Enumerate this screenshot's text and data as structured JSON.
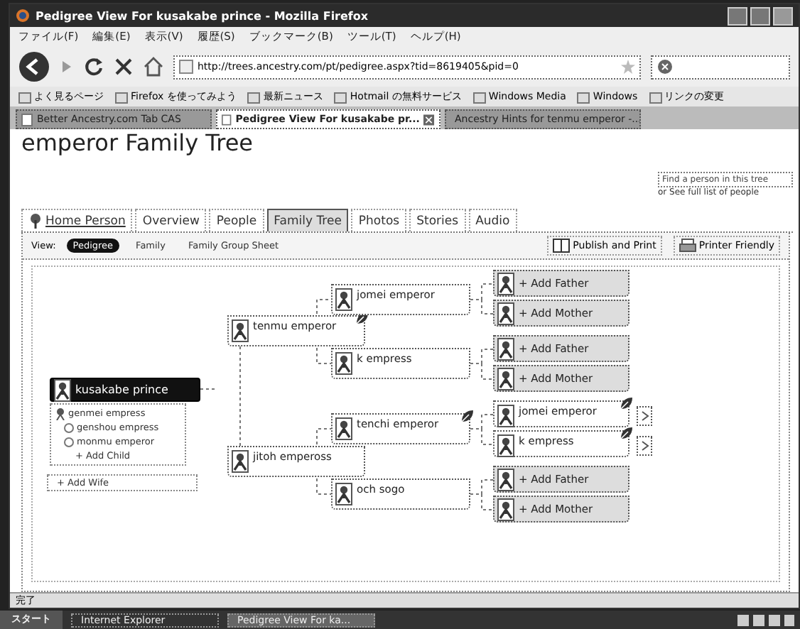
{
  "window": {
    "title": "Pedigree View For kusakabe prince - Mozilla Firefox"
  },
  "menu": [
    "ファイル(F)",
    "編集(E)",
    "表示(V)",
    "履歴(S)",
    "ブックマーク(B)",
    "ツール(T)",
    "ヘルプ(H)"
  ],
  "address": {
    "value": "http://trees.ancestry.com/pt/pedigree.aspx?tid=8619405&pid=0"
  },
  "bookmarks": [
    "よく見るページ",
    "Firefox を使ってみよう",
    "最新ニュース",
    "Hotmail の無料サービス",
    "Windows Media",
    "Windows",
    "リンクの変更"
  ],
  "browser_tabs": [
    {
      "label": "Better Ancestry.com Tab CAS",
      "selected": false
    },
    {
      "label": "Pedigree View For kusakabe pr...",
      "selected": true
    },
    {
      "label": "Ancestry Hints for tenmu emperor -...",
      "selected": false
    }
  ],
  "page": {
    "title": "emperor Family Tree",
    "find_placeholder": "Find a person in this tree",
    "list_link": "or See full list of people"
  },
  "site_tabs": [
    {
      "label": "Home Person",
      "kind": "home",
      "selected": false
    },
    {
      "label": "Overview",
      "kind": "plain",
      "selected": false
    },
    {
      "label": "People",
      "kind": "plain",
      "selected": false
    },
    {
      "label": "Family Tree",
      "kind": "plain",
      "selected": true
    },
    {
      "label": "Photos",
      "kind": "plain",
      "selected": false
    },
    {
      "label": "Stories",
      "kind": "plain",
      "selected": false
    },
    {
      "label": "Audio",
      "kind": "plain",
      "selected": false
    }
  ],
  "view": {
    "label": "View:",
    "options": [
      {
        "label": "Pedigree",
        "selected": true
      },
      {
        "label": "Family",
        "selected": false
      },
      {
        "label": "Family Group Sheet",
        "selected": false
      }
    ],
    "actions": [
      "Publish and Print",
      "Printer Friendly"
    ]
  },
  "pedigree": {
    "person": {
      "name": "kusakabe prince",
      "selected": true
    },
    "family": {
      "spouse": "genmei empress",
      "children": [
        "genshou empress",
        "monmu emperor"
      ],
      "add_child": "+ Add Child",
      "add_spouse": "+ Add Wife"
    },
    "parents": [
      {
        "kind": "person",
        "name": "tenmu emperor",
        "hint": true,
        "selected": false,
        "parents": [
          {
            "kind": "person",
            "name": "jomei emperor",
            "hint": false,
            "selected": false,
            "parents": [
              {
                "kind": "add",
                "label": "+ Add Father"
              },
              {
                "kind": "add",
                "label": "+ Add Mother"
              }
            ]
          },
          {
            "kind": "person",
            "name": "k empress",
            "hint": false,
            "selected": false,
            "parents": [
              {
                "kind": "add",
                "label": "+ Add Father"
              },
              {
                "kind": "add",
                "label": "+ Add Mother"
              }
            ]
          }
        ]
      },
      {
        "kind": "person",
        "name": "jitoh empeross",
        "hint": false,
        "selected": false,
        "parents": [
          {
            "kind": "person",
            "name": "tenchi emperor",
            "hint": true,
            "selected": false,
            "parents": [
              {
                "kind": "person",
                "name": "jomei emperor",
                "hint": true,
                "more": true,
                "selected": false
              },
              {
                "kind": "person",
                "name": "k empress",
                "hint": true,
                "more": true,
                "selected": false
              }
            ]
          },
          {
            "kind": "person",
            "name": "och sogo",
            "hint": false,
            "selected": false,
            "parents": [
              {
                "kind": "add",
                "label": "+ Add Father"
              },
              {
                "kind": "add",
                "label": "+ Add Mother"
              }
            ]
          }
        ]
      }
    ]
  },
  "status_bar": {
    "text": "完了"
  },
  "taskbar": {
    "start": "スタート",
    "items": [
      {
        "label": "Internet Explorer",
        "selected": false
      },
      {
        "label": "Pedigree View For ka...",
        "selected": true
      }
    ]
  }
}
